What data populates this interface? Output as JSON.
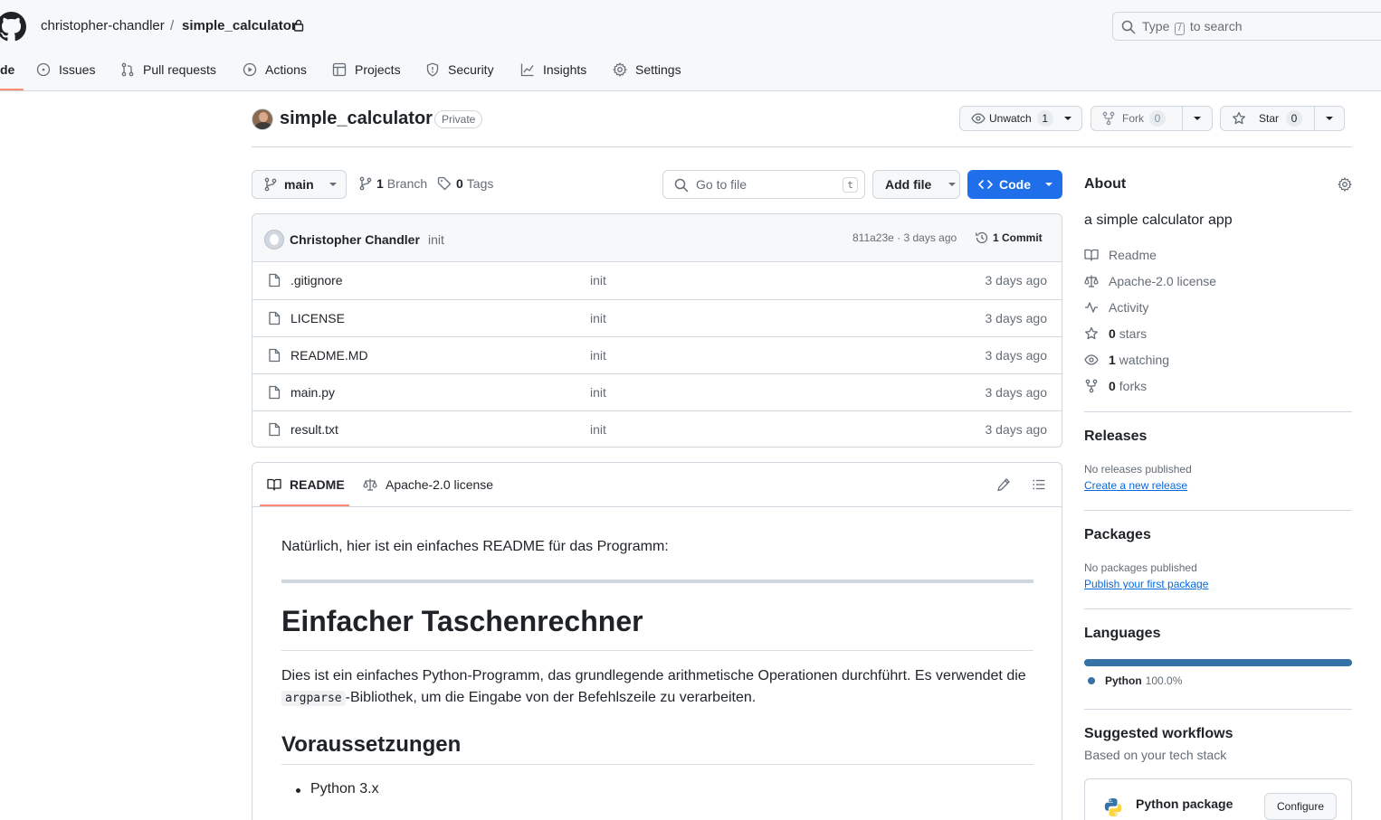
{
  "header": {
    "owner": "christopher-chandler",
    "separator": "/",
    "repo": "simple_calculator",
    "search_prefix": "Type",
    "search_key": "/",
    "search_suffix": "to search"
  },
  "nav": {
    "code_partial": "de",
    "tabs": [
      {
        "label": "Issues",
        "icon": "issue-icon"
      },
      {
        "label": "Pull requests",
        "icon": "pull-request-icon"
      },
      {
        "label": "Actions",
        "icon": "play-icon"
      },
      {
        "label": "Projects",
        "icon": "table-icon"
      },
      {
        "label": "Security",
        "icon": "shield-icon"
      },
      {
        "label": "Insights",
        "icon": "graph-icon"
      },
      {
        "label": "Settings",
        "icon": "gear-icon"
      }
    ]
  },
  "repo": {
    "title": "simple_calculator",
    "visibility": "Private",
    "unwatch_label": "Unwatch",
    "watch_count": "1",
    "fork_label": "Fork",
    "fork_count": "0",
    "star_label": "Star",
    "star_count": "0"
  },
  "toolbar": {
    "branch": "main",
    "branch_count": "1",
    "branch_label": "Branch",
    "tag_count": "0",
    "tag_label": "Tags",
    "goto_placeholder": "Go to file",
    "goto_key": "t",
    "add_file": "Add file",
    "code": "Code"
  },
  "commit": {
    "author": "Christopher Chandler",
    "message": "init",
    "meta": "811a23e · 3 days ago",
    "count_label": "1 Commit"
  },
  "files": [
    {
      "name": ".gitignore",
      "message": "init",
      "date": "3 days ago"
    },
    {
      "name": "LICENSE",
      "message": "init",
      "date": "3 days ago"
    },
    {
      "name": "README.MD",
      "message": "init",
      "date": "3 days ago"
    },
    {
      "name": "main.py",
      "message": "init",
      "date": "3 days ago"
    },
    {
      "name": "result.txt",
      "message": "init",
      "date": "3 days ago"
    }
  ],
  "readme": {
    "tab_readme": "README",
    "tab_license": "Apache-2.0 license",
    "intro": "Natürlich, hier ist ein einfaches README für das Programm:",
    "h1": "Einfacher Taschenrechner",
    "para_part1": "Dies ist ein einfaches Python-Programm, das grundlegende arithmetische Operationen durchführt. Es verwendet die ",
    "para_code": "argparse",
    "para_part2": "-Bibliothek, um die Eingabe von der Befehlszeile zu verarbeiten.",
    "h2": "Voraussetzungen",
    "list": [
      "Python 3.x"
    ]
  },
  "sidebar": {
    "about_title": "About",
    "description": "a simple calculator app",
    "items": [
      {
        "icon": "book-icon",
        "count": "",
        "label": "Readme"
      },
      {
        "icon": "law-icon",
        "count": "",
        "label": "Apache-2.0 license"
      },
      {
        "icon": "pulse-icon",
        "count": "",
        "label": "Activity"
      },
      {
        "icon": "star-icon",
        "count": "0",
        "label": "stars"
      },
      {
        "icon": "eye-icon",
        "count": "1",
        "label": "watching"
      },
      {
        "icon": "fork-icon",
        "count": "0",
        "label": "forks"
      }
    ],
    "releases_title": "Releases",
    "releases_empty": "No releases published",
    "releases_link": "Create a new release",
    "packages_title": "Packages",
    "packages_empty": "No packages published",
    "packages_link": "Publish your first package",
    "languages_title": "Languages",
    "languages": [
      {
        "name": "Python",
        "percent": "100.0%",
        "color": "#3572A5"
      }
    ],
    "workflows_title": "Suggested workflows",
    "workflows_subtitle": "Based on your tech stack",
    "workflow_name": "Python package",
    "workflow_button": "Configure"
  },
  "colors": {
    "accent": "#1f6feb",
    "underline": "#fd8c73",
    "link": "#0969da"
  }
}
